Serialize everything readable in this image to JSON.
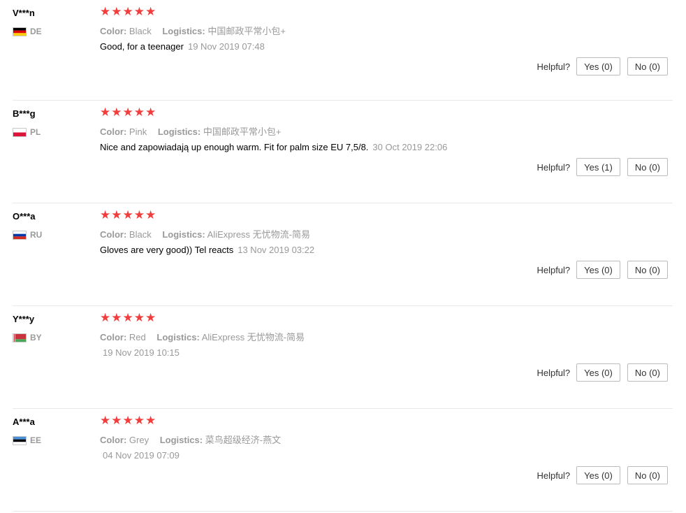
{
  "reviews": [
    {
      "user": "V***n",
      "country": "DE",
      "flag": "de",
      "rating": 5,
      "color_label": "Color:",
      "color": "Black",
      "logistics_label": "Logistics:",
      "logistics": "中国邮政平常小包+",
      "text": "Good, for a teenager",
      "date": "19 Nov 2019 07:48",
      "helpful_label": "Helpful?",
      "yes": "Yes (0)",
      "no": "No (0)"
    },
    {
      "user": "B***g",
      "country": "PL",
      "flag": "pl",
      "rating": 5,
      "color_label": "Color:",
      "color": "Pink",
      "logistics_label": "Logistics:",
      "logistics": "中国邮政平常小包+",
      "text": "Nice and zapowiadają up enough warm. Fit for palm size EU 7,5/8.",
      "date": "30 Oct 2019 22:06",
      "helpful_label": "Helpful?",
      "yes": "Yes (1)",
      "no": "No (0)"
    },
    {
      "user": "O***a",
      "country": "RU",
      "flag": "ru",
      "rating": 5,
      "color_label": "Color:",
      "color": "Black",
      "logistics_label": "Logistics:",
      "logistics": "AliExpress 无忧物流-简易",
      "text": "Gloves are very good)) Tel reacts",
      "date": "13 Nov 2019 03:22",
      "helpful_label": "Helpful?",
      "yes": "Yes (0)",
      "no": "No (0)"
    },
    {
      "user": "Y***y",
      "country": "BY",
      "flag": "by",
      "rating": 5,
      "color_label": "Color:",
      "color": "Red",
      "logistics_label": "Logistics:",
      "logistics": "AliExpress 无忧物流-简易",
      "text": "",
      "date": "19 Nov 2019 10:15",
      "helpful_label": "Helpful?",
      "yes": "Yes (0)",
      "no": "No (0)"
    },
    {
      "user": "A***a",
      "country": "EE",
      "flag": "ee",
      "rating": 5,
      "color_label": "Color:",
      "color": "Grey",
      "logistics_label": "Logistics:",
      "logistics": "菜鸟超级经济-燕文",
      "text": "",
      "date": "04 Nov 2019 07:09",
      "helpful_label": "Helpful?",
      "yes": "Yes (0)",
      "no": "No (0)"
    }
  ],
  "colors": {
    "star": "#f23d3d",
    "muted": "#999999",
    "divider": "#e8e8e8"
  }
}
